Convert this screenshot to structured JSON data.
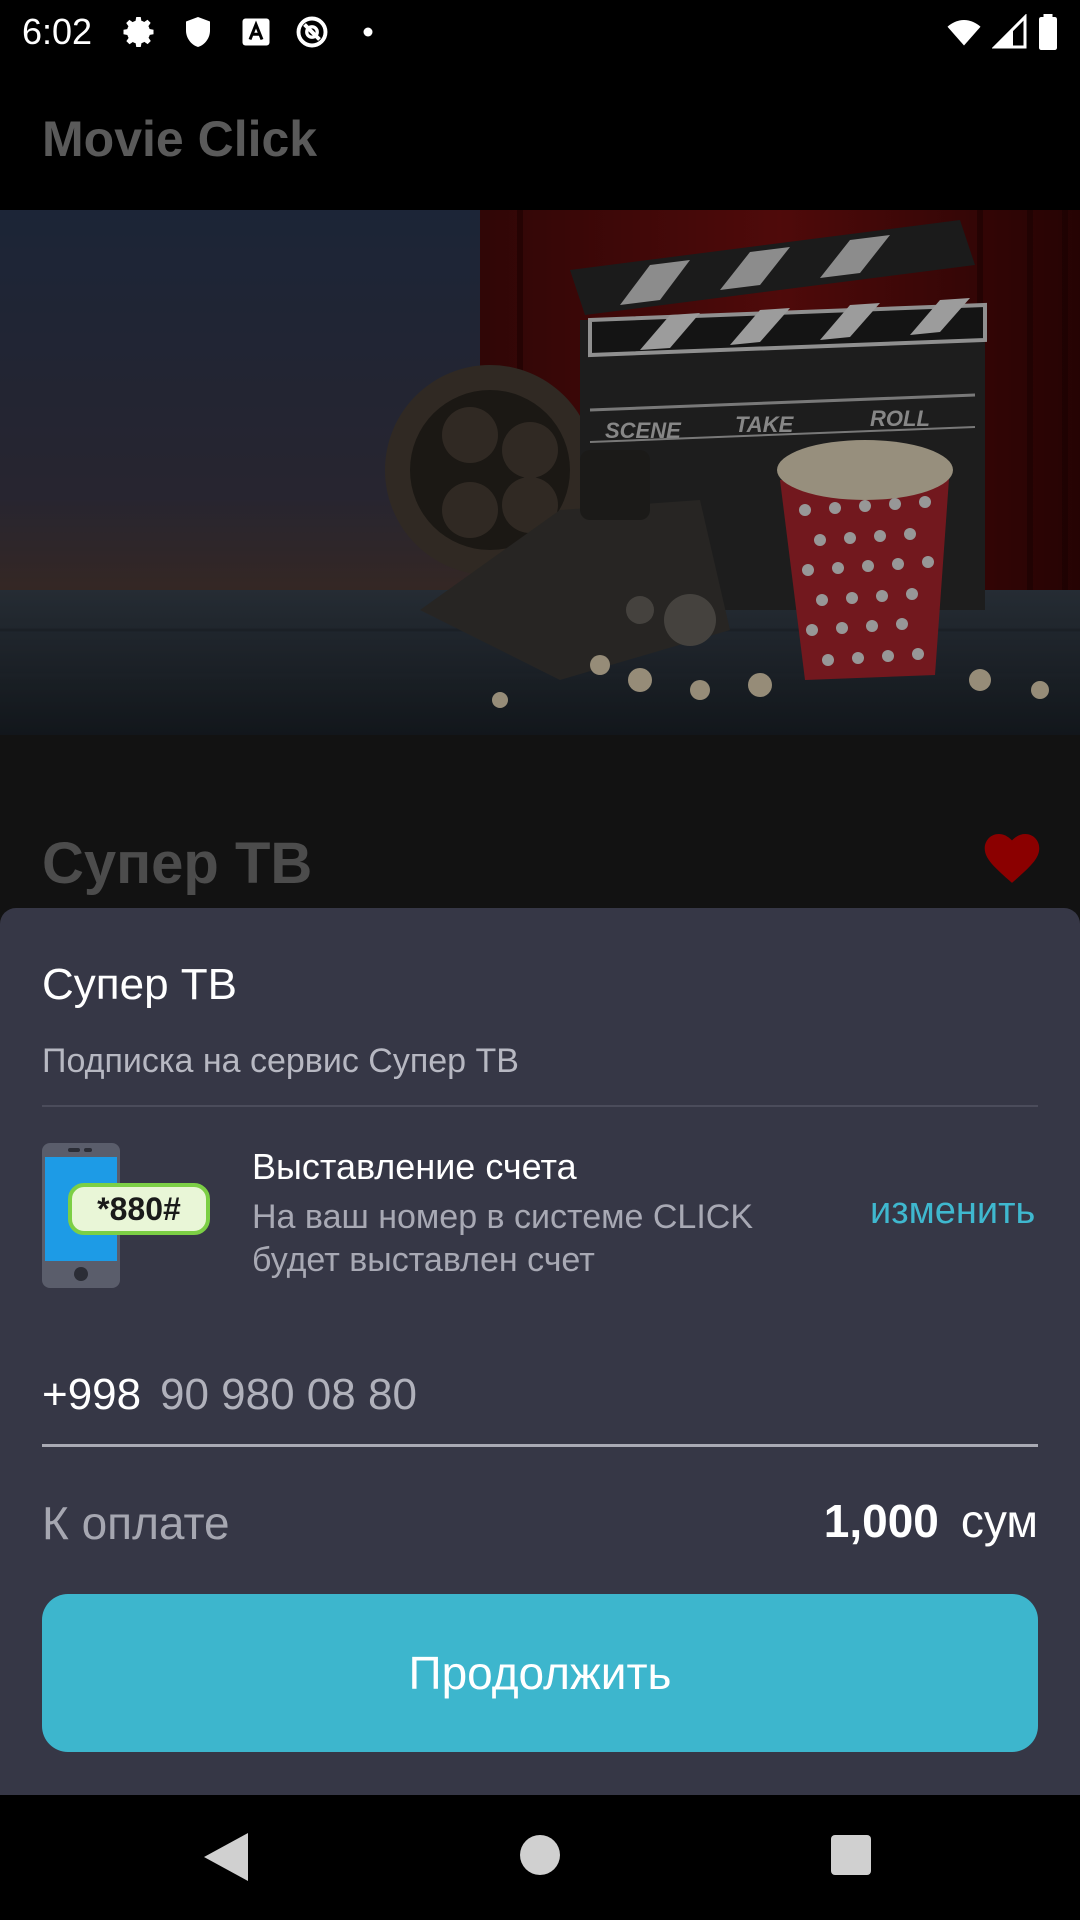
{
  "status_bar": {
    "time": "6:02"
  },
  "app_bar": {
    "title": "Movie Click"
  },
  "hero": {
    "clapper_words": [
      "SCENE",
      "TAKE",
      "ROLL"
    ]
  },
  "page": {
    "service_title": "Супер ТВ"
  },
  "sheet": {
    "title": "Супер ТВ",
    "subtitle": "Подписка на сервис Супер ТВ",
    "billing": {
      "ussd_code": "*880#",
      "title": "Выставление счета",
      "description": "На ваш номер в системе CLICK будет выставлен счет",
      "change_label": "изменить"
    },
    "phone": {
      "prefix": "+998",
      "number": "90 980 08 80"
    },
    "payment": {
      "label": "К оплате",
      "amount": "1,000",
      "currency": "сум"
    },
    "continue_label": "Продолжить"
  },
  "colors": {
    "accent": "#3db6cd",
    "sheet_bg": "#363746",
    "heart": "#8b0000"
  }
}
